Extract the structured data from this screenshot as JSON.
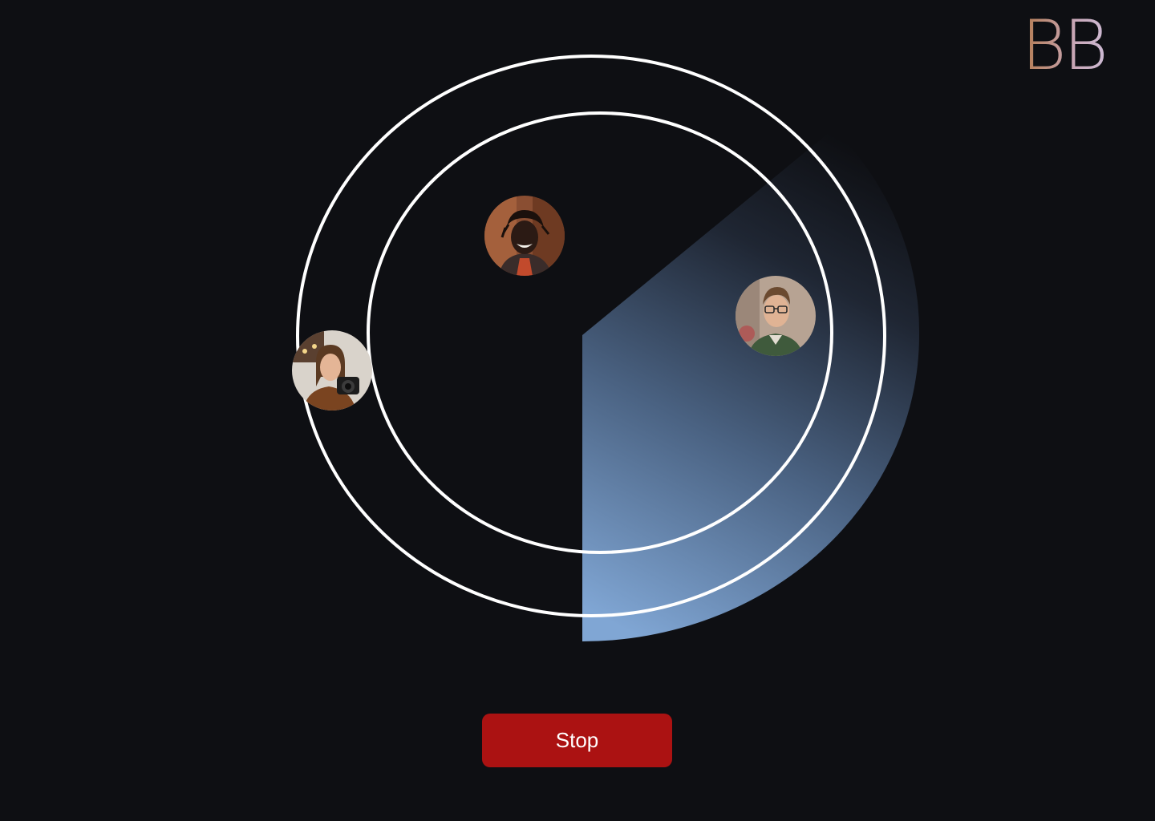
{
  "logo": {
    "text": "BB"
  },
  "radar": {
    "sweep_color_dark": "#1c2028",
    "sweep_color_light": "#80a6d4",
    "ring_color": "#ffffff"
  },
  "avatars": [
    {
      "id": "avatar-top-user",
      "icon": "person-smiling-avatar"
    },
    {
      "id": "avatar-right-user",
      "icon": "person-glasses-avatar"
    },
    {
      "id": "avatar-left-user",
      "icon": "person-camera-avatar"
    }
  ],
  "controls": {
    "stop_label": "Stop",
    "stop_color": "#ab1212"
  }
}
